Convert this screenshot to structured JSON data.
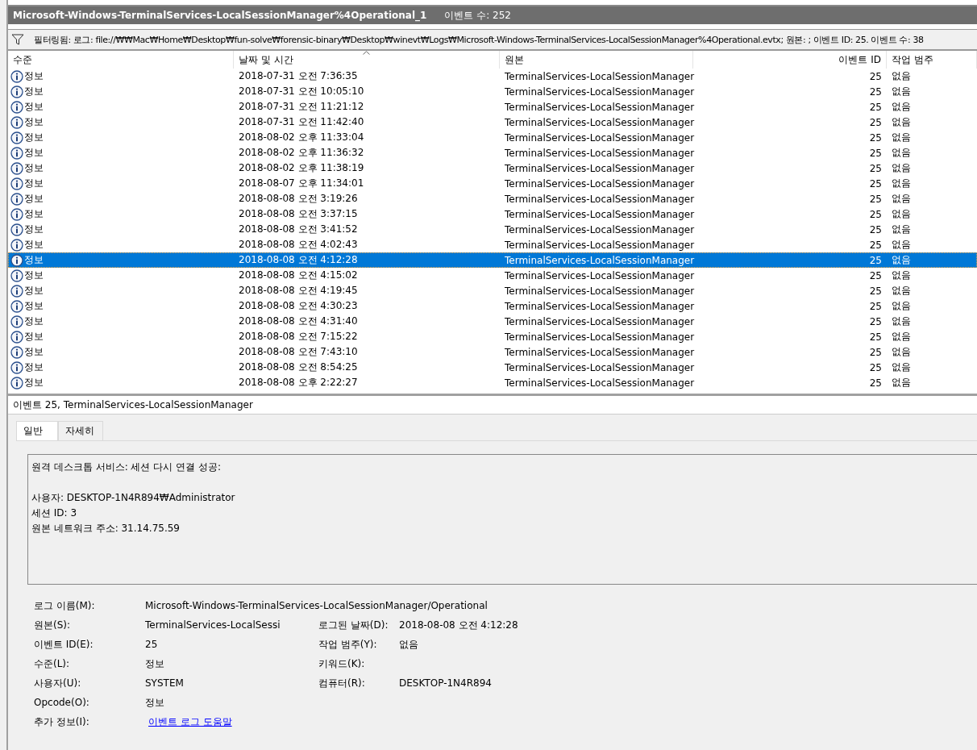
{
  "log_panel": {
    "title": "Microsoft-Windows-TerminalServices-LocalSessionManager%4Operational_1",
    "event_count": "이벤트 수: 252"
  },
  "filter": {
    "text": "필터링됨: 로그: file://₩₩Mac₩Home₩Desktop₩fun-solve₩forensic-binary₩Desktop₩winevt₩Logs₩Microsoft-Windows-TerminalServices-LocalSessionManager%4Operational.evtx; 원본: ; 이벤트 ID: 25. 이벤트 수: 38"
  },
  "table": {
    "columns": [
      "수준",
      "날짜 및 시간",
      "원본",
      "이벤트 ID",
      "작업 범주"
    ],
    "rows": [
      {
        "level": "정보",
        "date": "2018-07-31 오전 7:36:35",
        "source": "TerminalServices-LocalSessionManager",
        "event_id": "25",
        "category": "없음",
        "selected": false
      },
      {
        "level": "정보",
        "date": "2018-07-31 오전 10:05:10",
        "source": "TerminalServices-LocalSessionManager",
        "event_id": "25",
        "category": "없음",
        "selected": false
      },
      {
        "level": "정보",
        "date": "2018-07-31 오전 11:21:12",
        "source": "TerminalServices-LocalSessionManager",
        "event_id": "25",
        "category": "없음",
        "selected": false
      },
      {
        "level": "정보",
        "date": "2018-07-31 오전 11:42:40",
        "source": "TerminalServices-LocalSessionManager",
        "event_id": "25",
        "category": "없음",
        "selected": false
      },
      {
        "level": "정보",
        "date": "2018-08-02 오후 11:33:04",
        "source": "TerminalServices-LocalSessionManager",
        "event_id": "25",
        "category": "없음",
        "selected": false
      },
      {
        "level": "정보",
        "date": "2018-08-02 오후 11:36:32",
        "source": "TerminalServices-LocalSessionManager",
        "event_id": "25",
        "category": "없음",
        "selected": false
      },
      {
        "level": "정보",
        "date": "2018-08-02 오후 11:38:19",
        "source": "TerminalServices-LocalSessionManager",
        "event_id": "25",
        "category": "없음",
        "selected": false
      },
      {
        "level": "정보",
        "date": "2018-08-07 오후 11:34:01",
        "source": "TerminalServices-LocalSessionManager",
        "event_id": "25",
        "category": "없음",
        "selected": false
      },
      {
        "level": "정보",
        "date": "2018-08-08 오전 3:19:26",
        "source": "TerminalServices-LocalSessionManager",
        "event_id": "25",
        "category": "없음",
        "selected": false
      },
      {
        "level": "정보",
        "date": "2018-08-08 오전 3:37:15",
        "source": "TerminalServices-LocalSessionManager",
        "event_id": "25",
        "category": "없음",
        "selected": false
      },
      {
        "level": "정보",
        "date": "2018-08-08 오전 3:41:52",
        "source": "TerminalServices-LocalSessionManager",
        "event_id": "25",
        "category": "없음",
        "selected": false
      },
      {
        "level": "정보",
        "date": "2018-08-08 오전 4:02:43",
        "source": "TerminalServices-LocalSessionManager",
        "event_id": "25",
        "category": "없음",
        "selected": false
      },
      {
        "level": "정보",
        "date": "2018-08-08 오전 4:12:28",
        "source": "TerminalServices-LocalSessionManager",
        "event_id": "25",
        "category": "없음",
        "selected": true
      },
      {
        "level": "정보",
        "date": "2018-08-08 오전 4:15:02",
        "source": "TerminalServices-LocalSessionManager",
        "event_id": "25",
        "category": "없음",
        "selected": false
      },
      {
        "level": "정보",
        "date": "2018-08-08 오전 4:19:45",
        "source": "TerminalServices-LocalSessionManager",
        "event_id": "25",
        "category": "없음",
        "selected": false
      },
      {
        "level": "정보",
        "date": "2018-08-08 오전 4:30:23",
        "source": "TerminalServices-LocalSessionManager",
        "event_id": "25",
        "category": "없음",
        "selected": false
      },
      {
        "level": "정보",
        "date": "2018-08-08 오전 4:31:40",
        "source": "TerminalServices-LocalSessionManager",
        "event_id": "25",
        "category": "없음",
        "selected": false
      },
      {
        "level": "정보",
        "date": "2018-08-08 오전 7:15:22",
        "source": "TerminalServices-LocalSessionManager",
        "event_id": "25",
        "category": "없음",
        "selected": false
      },
      {
        "level": "정보",
        "date": "2018-08-08 오전 7:43:10",
        "source": "TerminalServices-LocalSessionManager",
        "event_id": "25",
        "category": "없음",
        "selected": false
      },
      {
        "level": "정보",
        "date": "2018-08-08 오전 8:54:25",
        "source": "TerminalServices-LocalSessionManager",
        "event_id": "25",
        "category": "없음",
        "selected": false
      },
      {
        "level": "정보",
        "date": "2018-08-08 오후 2:22:27",
        "source": "TerminalServices-LocalSessionManager",
        "event_id": "25",
        "category": "없음",
        "selected": false
      }
    ]
  },
  "details": {
    "title": "이벤트 25, TerminalServices-LocalSessionManager",
    "tabs": [
      {
        "label": "일반",
        "selected": true
      },
      {
        "label": "자세히",
        "selected": false
      }
    ],
    "message": [
      [
        "원격 데스크톱 서비스: 세션 다시 연결 성공:"
      ],
      [
        "사용자: DESKTOP-1N4R894₩Administrator",
        "세션 ID: 3",
        "원본 네트워크 주소: 31.14.75.59"
      ]
    ],
    "log_name": {
      "label": "로그 이름(M):",
      "value": "Microsoft-Windows-TerminalServices-LocalSessionManager/Operational"
    },
    "fields": [
      {
        "label": "원본(S):",
        "value": "TerminalServices-LocalSessi",
        "label2": "로그된 날짜(D):",
        "value2": "2018-08-08 오전 4:12:28"
      },
      {
        "label": "이벤트 ID(E):",
        "value": "25",
        "label2": "작업 범주(Y):",
        "value2": "없음"
      },
      {
        "label": "수준(L):",
        "value": "정보",
        "label2": "키워드(K):"
      },
      {
        "label": "사용자(U):",
        "value": "SYSTEM",
        "label2": "컴퓨터(R):",
        "value2": "DESKTOP-1N4R894"
      },
      {
        "label": "Opcode(O):",
        "value": "정보"
      }
    ],
    "more_info": {
      "label": "추가 정보(I):",
      "link": "이벤트 로그 도움말"
    }
  }
}
